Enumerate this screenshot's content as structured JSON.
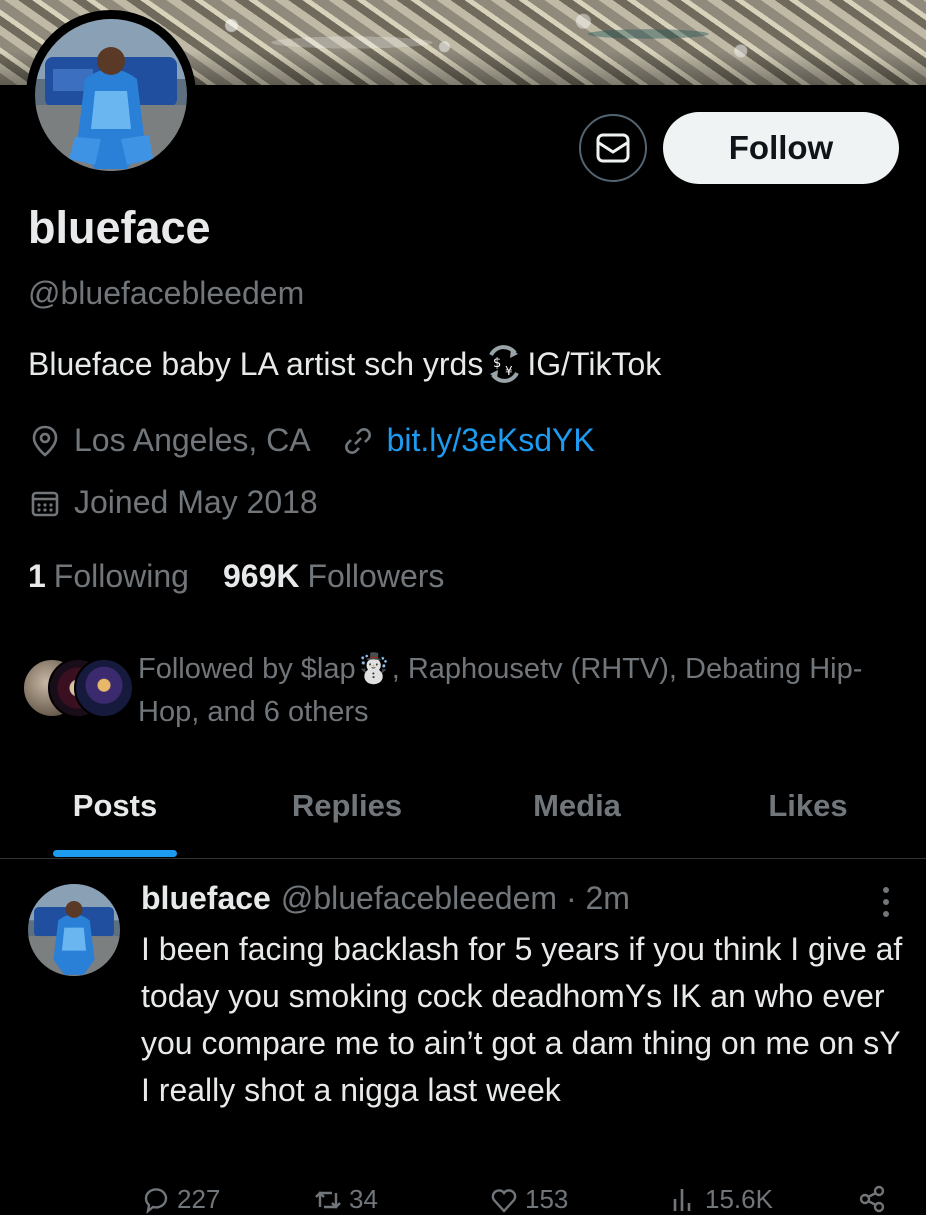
{
  "profile": {
    "display_name": "blueface",
    "handle": "@bluefacebleedem",
    "bio_text": "Blueface baby LA artist sch yrds",
    "bio_emoji": "currency-exchange-emoji",
    "bio_suffix": "IG/TikTok",
    "location": "Los Angeles, CA",
    "website": "bit.ly/3eKsdYK",
    "joined": "Joined May 2018",
    "following_count": "1",
    "following_label": "Following",
    "followers_count": "969K",
    "followers_label": "Followers",
    "followed_by": "Followed by $lap☃️, Raphousetv (RHTV), Debating Hip-Hop, and 6 others"
  },
  "actions": {
    "follow_label": "Follow",
    "message_icon": "mail-icon"
  },
  "tabs": [
    {
      "label": "Posts",
      "active": true
    },
    {
      "label": "Replies",
      "active": false
    },
    {
      "label": "Media",
      "active": false
    },
    {
      "label": "Likes",
      "active": false
    }
  ],
  "post": {
    "author": "blueface",
    "handle": "@bluefacebleedem",
    "time": "· 2m",
    "text": "I been facing backlash for 5 years if you think I give af today you smoking cock deadhomYs IK an who ever you compare me to ain’t got a dam thing on me on sY I really shot a nigga last week",
    "counts": {
      "replies": "227",
      "reposts": "34",
      "likes": "153",
      "views": "15.6K"
    }
  },
  "colors": {
    "background": "#000000",
    "primary_text": "#e7e9ea",
    "secondary_text": "#71767b",
    "accent": "#1d9bf0"
  }
}
